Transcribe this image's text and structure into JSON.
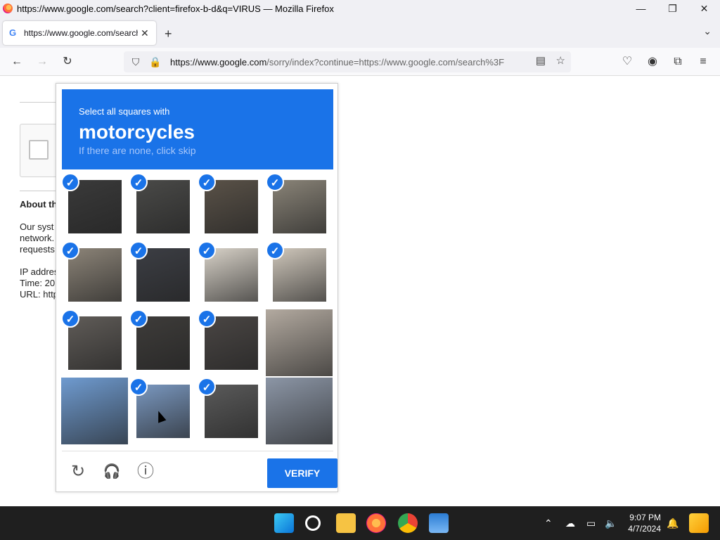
{
  "window": {
    "title": "https://www.google.com/search?client=firefox-b-d&q=VIRUS — Mozilla Firefox",
    "minimize": "—",
    "maximize": "❐",
    "close": "✕"
  },
  "tab": {
    "favicon": "G",
    "label": "https://www.google.com/search?client=firefox-b-d&q=VIRUS",
    "close": "✕"
  },
  "tabstrip": {
    "new_tab": "+",
    "list_all": "⌄"
  },
  "nav": {
    "back": "←",
    "forward": "→",
    "reload": "↻",
    "url_host": "https://www.google.com",
    "url_rest": "/sorry/index?continue=https://www.google.com/search%3F"
  },
  "page": {
    "about_heading": "About th",
    "text_lines": [
      "Our syst",
      "network.",
      "requests",
      "",
      "IP addres",
      "Time: 20",
      "URL: http"
    ]
  },
  "captcha": {
    "header_line1": "Select all squares with",
    "header_target": "motorcycles",
    "header_line3": "If there are none, click skip",
    "check_mark": "✓",
    "verify_label": "VERIFY",
    "reload_icon": "↻",
    "audio_icon": "🎧",
    "info_icon": "ⓘ",
    "tiles": [
      {
        "selected": true,
        "color": "#3a3a3a"
      },
      {
        "selected": true,
        "color": "#4a4a48"
      },
      {
        "selected": true,
        "color": "#5a5248"
      },
      {
        "selected": true,
        "color": "#8a8478"
      },
      {
        "selected": true,
        "color": "#8c8478"
      },
      {
        "selected": true,
        "color": "#3c3e44"
      },
      {
        "selected": true,
        "color": "#d8d2c8"
      },
      {
        "selected": true,
        "color": "#cfc7bb"
      },
      {
        "selected": true,
        "color": "#605c58"
      },
      {
        "selected": true,
        "color": "#3e3c3a"
      },
      {
        "selected": true,
        "color": "#4a4644"
      },
      {
        "selected": false,
        "color": "#b3aaa0"
      },
      {
        "selected": false,
        "color": "#6f9bd0"
      },
      {
        "selected": true,
        "color": "#7a98c0"
      },
      {
        "selected": true,
        "color": "#5a5a5a"
      },
      {
        "selected": false,
        "color": "#8c96a6"
      }
    ]
  },
  "taskbar": {
    "time": "9:07 PM",
    "date": "4/7/2024",
    "tray_chevron": "⌃"
  }
}
